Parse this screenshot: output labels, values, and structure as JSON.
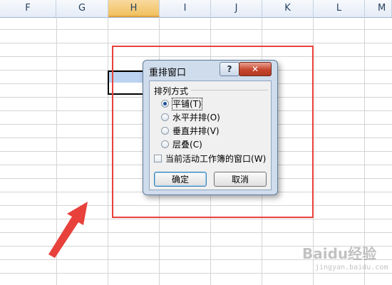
{
  "columns": [
    "F",
    "G",
    "H",
    "I",
    "J",
    "K",
    "L",
    "M"
  ],
  "selected_column": "H",
  "dialog": {
    "title": "重排窗口",
    "help_label": "?",
    "close_label": "✕",
    "group_label": "排列方式",
    "options": [
      {
        "label": "平铺",
        "key": "(T)",
        "checked": true
      },
      {
        "label": "水平并排",
        "key": "(O)",
        "checked": false
      },
      {
        "label": "垂直并排",
        "key": "(V)",
        "checked": false
      },
      {
        "label": "层叠",
        "key": "(C)",
        "checked": false
      }
    ],
    "checkbox_label": "当前活动工作簿的窗口",
    "checkbox_key": "(W)",
    "checkbox_checked": false,
    "ok_label": "确定",
    "cancel_label": "取消"
  },
  "annotation_color": "#e8413c",
  "watermark": {
    "text": "Baidu经验",
    "sub": "jingyan.baidu.com"
  }
}
